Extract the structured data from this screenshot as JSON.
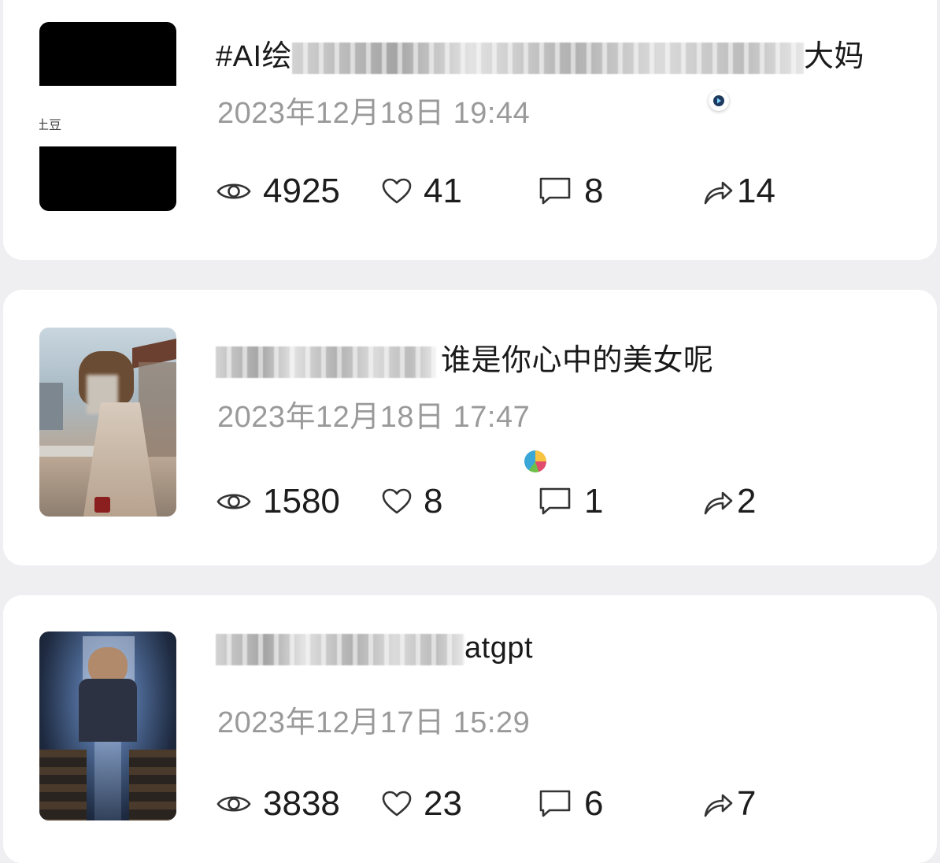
{
  "posts": [
    {
      "title_visible_start": "#AI绘",
      "title_visible_end": "大妈",
      "date": "2023年12月18日 19:44",
      "thumb_caption": "土豆",
      "stats": {
        "views": "4925",
        "likes": "41",
        "comments": "8",
        "shares": "14"
      }
    },
    {
      "title_visible_start": "",
      "title_visible_end": "谁是你心中的美女呢",
      "date": "2023年12月18日 17:47",
      "stats": {
        "views": "1580",
        "likes": "8",
        "comments": "1",
        "shares": "2"
      }
    },
    {
      "title_visible_start": "",
      "title_visible_end": "atgpt",
      "date": "2023年12月17日 15:29",
      "stats": {
        "views": "3838",
        "likes": "23",
        "comments": "6",
        "shares": "7"
      }
    }
  ],
  "icons": {
    "views": "eye-icon",
    "likes": "heart-icon",
    "comments": "comment-icon",
    "shares": "share-icon"
  },
  "colors": {
    "background": "#efeff1",
    "card": "#ffffff",
    "text": "#1a1a1a",
    "date": "#9a9a9a"
  }
}
